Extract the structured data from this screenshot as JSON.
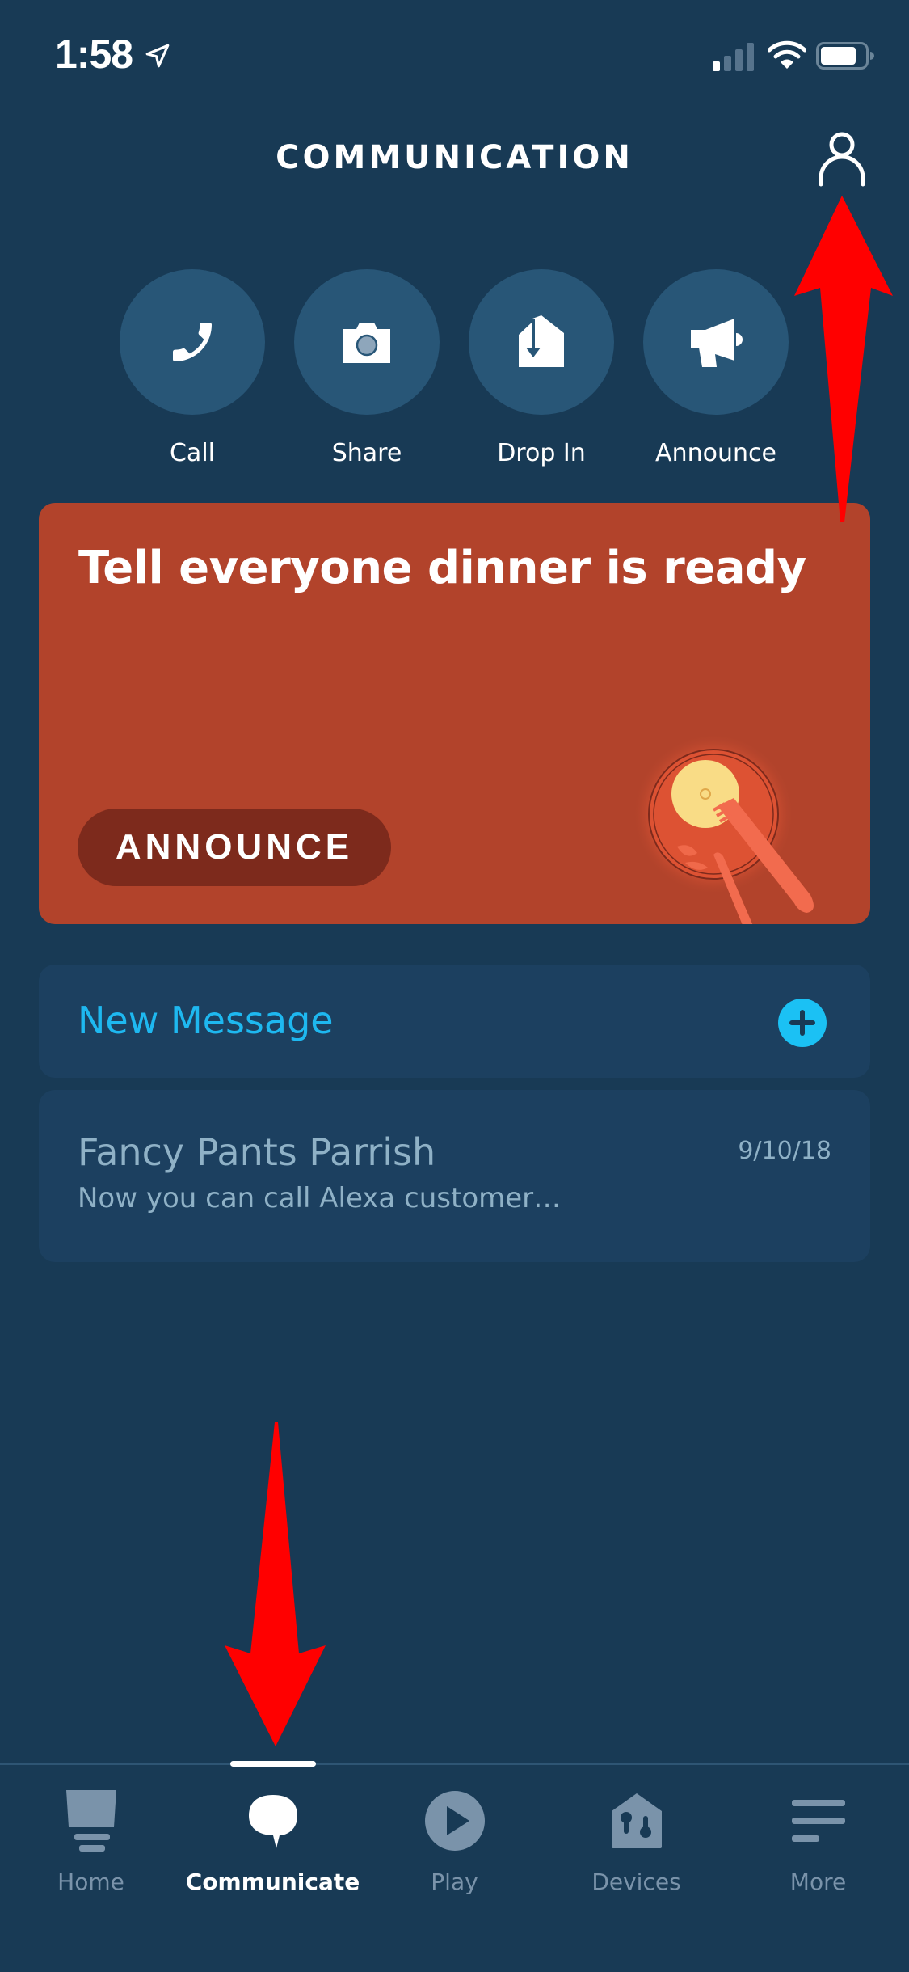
{
  "status_bar": {
    "time": "1:58",
    "signal_bars": 1,
    "signal_bars_total": 4,
    "battery_level": 0.8,
    "icons": [
      "location-arrow-icon",
      "signal-icon",
      "wifi-icon",
      "battery-icon"
    ]
  },
  "header": {
    "title": "COMMUNICATION",
    "profile_icon": "person-icon"
  },
  "actions": [
    {
      "label": "Call",
      "icon": "phone-icon"
    },
    {
      "label": "Share",
      "icon": "camera-icon"
    },
    {
      "label": "Drop In",
      "icon": "drop-in-icon"
    },
    {
      "label": "Announce",
      "icon": "megaphone-icon"
    }
  ],
  "promo_card": {
    "title": "Tell everyone dinner is ready",
    "button_label": "ANNOUNCE",
    "illustration": "dinner-plate-illustration",
    "color": "#b2432b"
  },
  "new_message": {
    "label": "New Message",
    "icon": "plus-circle-icon",
    "accent": "#1eb8f0"
  },
  "conversations": [
    {
      "name": "Fancy Pants Parrish",
      "date": "9/10/18",
      "preview": "Now you can call Alexa customer…"
    }
  ],
  "tabs": [
    {
      "label": "Home",
      "icon": "home-icon",
      "active": false
    },
    {
      "label": "Communicate",
      "icon": "chat-bubble-icon",
      "active": true
    },
    {
      "label": "Play",
      "icon": "play-icon",
      "active": false
    },
    {
      "label": "Devices",
      "icon": "devices-icon",
      "active": false
    },
    {
      "label": "More",
      "icon": "menu-icon",
      "active": false
    }
  ],
  "annotations": [
    "red-arrow-up-to-profile",
    "red-arrow-down-to-communicate-tab"
  ]
}
